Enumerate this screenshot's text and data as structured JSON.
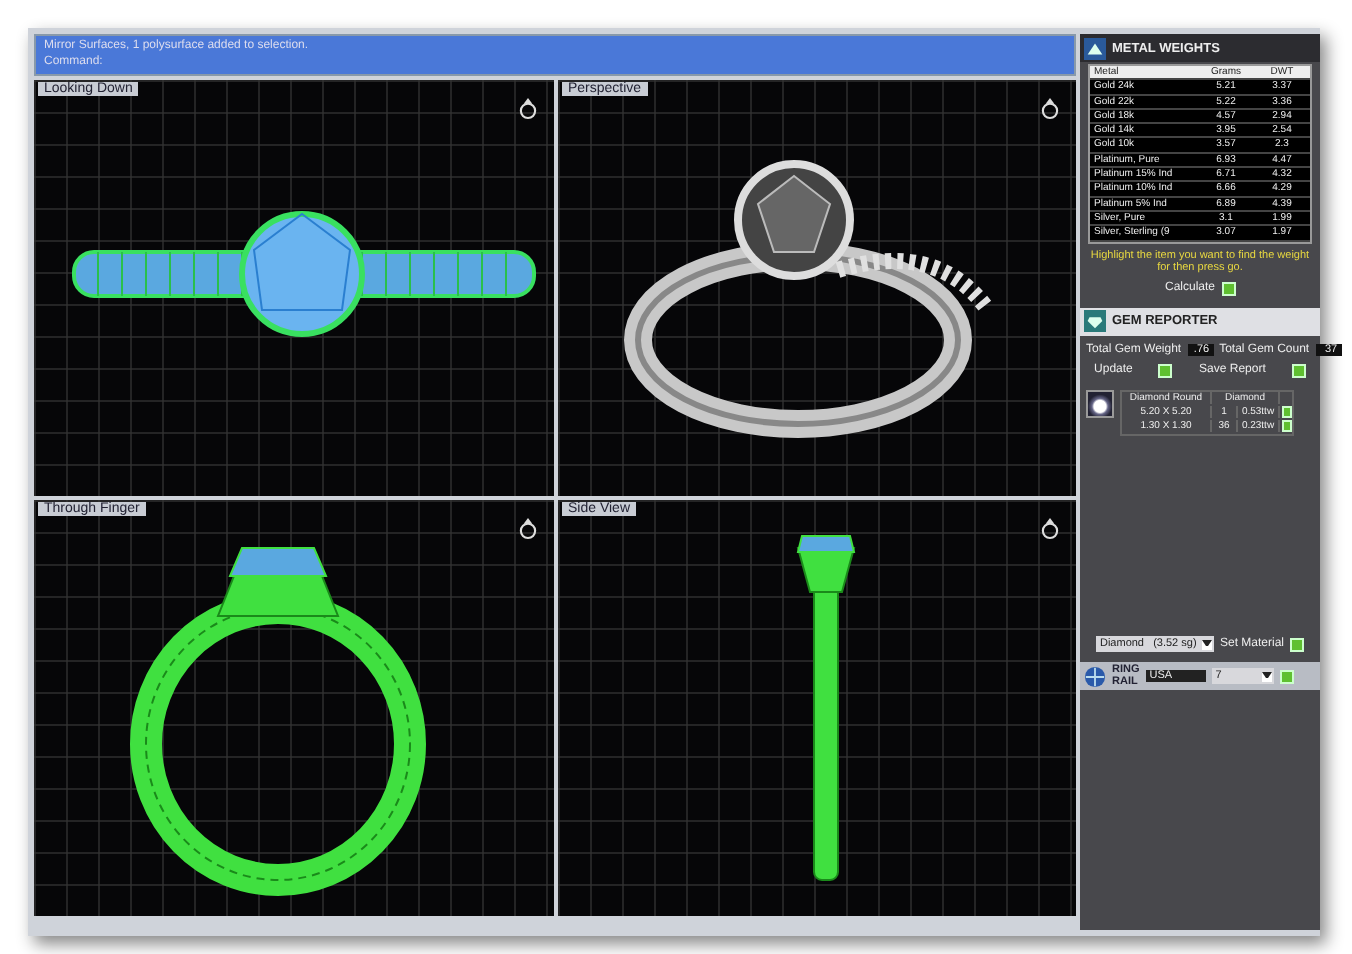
{
  "command_bar": {
    "lines": [
      "Mirror Surfaces, 1 polysurface added to selection.",
      "Command:"
    ]
  },
  "viewports": [
    {
      "label": "Looking Down",
      "kind": "top"
    },
    {
      "label": "Perspective",
      "kind": "perspective"
    },
    {
      "label": "Through Finger",
      "kind": "front"
    },
    {
      "label": "Side View",
      "kind": "side"
    }
  ],
  "metal_weights": {
    "title": "METAL WEIGHTS",
    "columns": [
      "Metal",
      "Grams",
      "DWT"
    ],
    "rows": [
      [
        "Gold 24k",
        "5.21",
        "3.37"
      ],
      [
        "Gold 22k",
        "5.22",
        "3.36"
      ],
      [
        "Gold 18k",
        "4.57",
        "2.94"
      ],
      [
        "Gold 14k",
        "3.95",
        "2.54"
      ],
      [
        "Gold 10k",
        "3.57",
        "2.3"
      ],
      [
        "Platinum, Pure",
        "6.93",
        "4.47"
      ],
      [
        "Platinum 15% Ind",
        "6.71",
        "4.32"
      ],
      [
        "Platinum 10% Ind",
        "6.66",
        "4.29"
      ],
      [
        "Platinum 5% Ind",
        "6.89",
        "4.39"
      ],
      [
        "Silver, Pure",
        "3.1",
        "1.99"
      ],
      [
        "Silver, Sterling (9",
        "3.07",
        "1.97"
      ]
    ],
    "hint": "Highlight the item you want to find the weight for then press go.",
    "calculate_label": "Calculate"
  },
  "gem_reporter": {
    "title": "GEM REPORTER",
    "weight_label": "Total Gem Weight",
    "weight": ".76",
    "count_label": "Total Gem Count",
    "count": "37",
    "update_label": "Update",
    "save_label": "Save Report",
    "columns": [
      "Diamond Round",
      "Diamond"
    ],
    "rows": [
      [
        "5.20 X 5.20",
        "1",
        "0.53ttw"
      ],
      [
        "1.30 X 1.30",
        "36",
        "0.23ttw"
      ]
    ],
    "material": "Diamond   (3.52 sg)",
    "set_material_label": "Set Material"
  },
  "ring_rail": {
    "title_1": "RING",
    "title_2": "RAIL",
    "country": "USA",
    "size": "7"
  }
}
